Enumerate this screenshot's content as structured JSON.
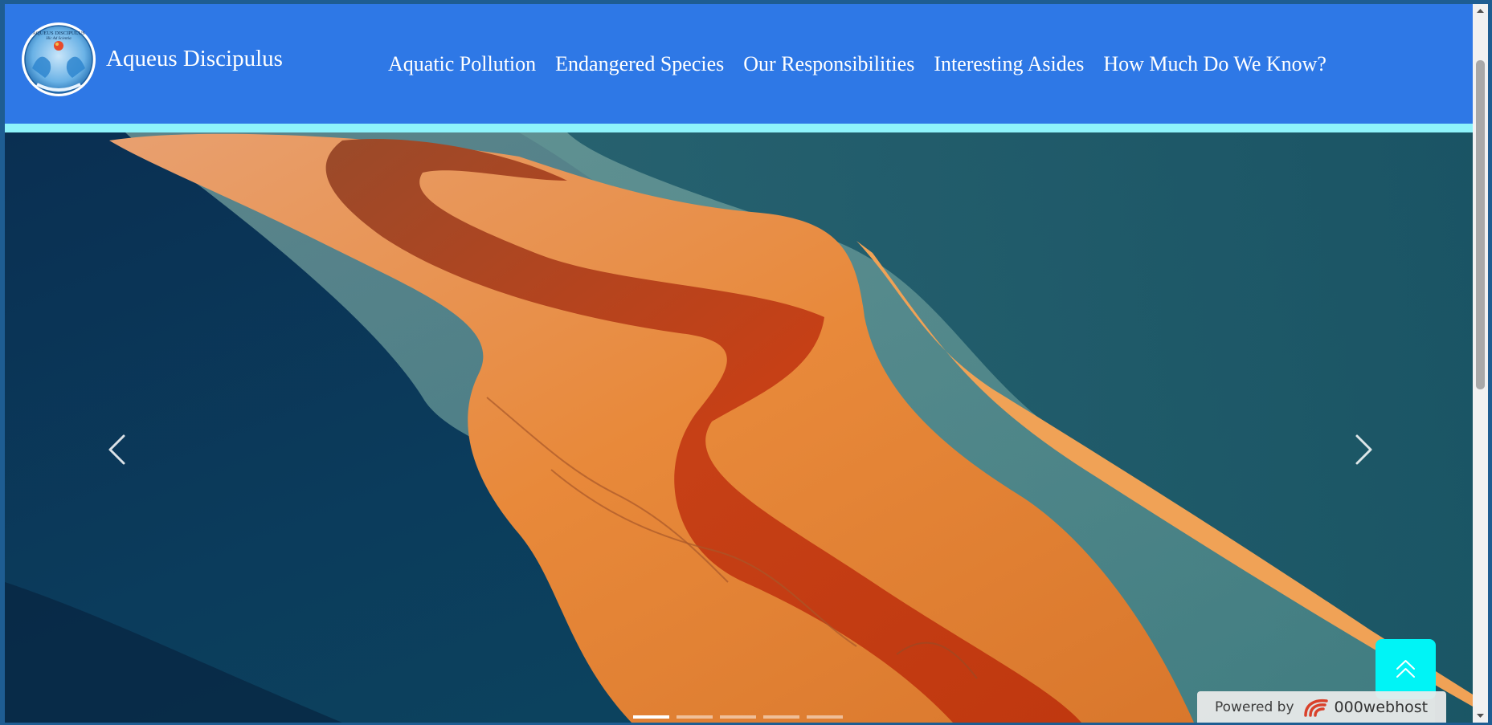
{
  "site": {
    "brand_name": "Aqueus Discipulus",
    "logo_top_text": "AQUEUS DISCIPULUS",
    "logo_motto": "Hic Ad Scientia"
  },
  "nav": {
    "items": [
      {
        "label": "Aquatic Pollution"
      },
      {
        "label": "Endangered Species"
      },
      {
        "label": "Our Responsibilities"
      },
      {
        "label": "Interesting Asides"
      },
      {
        "label": "How Much Do We Know?"
      }
    ]
  },
  "carousel": {
    "slide_count": 5,
    "active_index": 0,
    "prev_icon": "chevron-left-icon",
    "next_icon": "chevron-right-icon"
  },
  "back_to_top": {
    "icon": "double-chevron-up-icon"
  },
  "badge": {
    "label": "Powered by",
    "brand": "000webhost"
  },
  "colors": {
    "navbar": "#2e78e6",
    "accent_strip": "#8ef3fb",
    "to_top": "#00f4f6"
  }
}
